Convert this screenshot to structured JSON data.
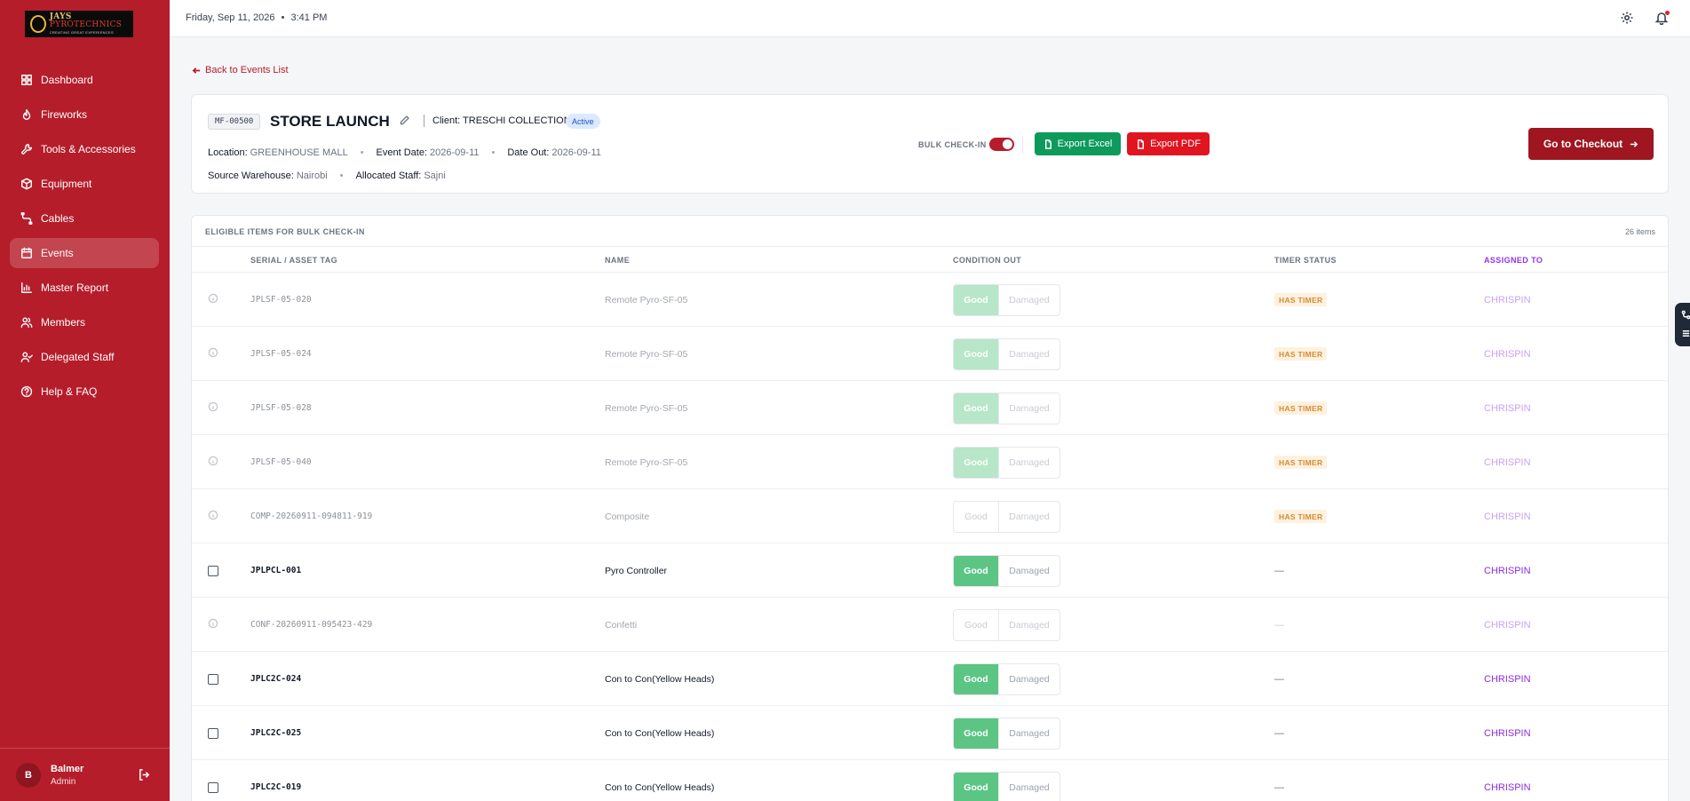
{
  "brand": {
    "logo_line1_a": "JAYS ",
    "logo_line1_b": "PYROTECHNICS",
    "logo_line2": "CREATING GREAT EXPERIENCES"
  },
  "sidebar": {
    "items": [
      {
        "label": "Dashboard",
        "icon": "grid-icon",
        "active": false
      },
      {
        "label": "Fireworks",
        "icon": "flame-icon",
        "active": false
      },
      {
        "label": "Tools & Accessories",
        "icon": "wrench-icon",
        "active": false
      },
      {
        "label": "Equipment",
        "icon": "box-icon",
        "active": false
      },
      {
        "label": "Cables",
        "icon": "cable-icon",
        "active": false
      },
      {
        "label": "Events",
        "icon": "calendar-icon",
        "active": true
      },
      {
        "label": "Master Report",
        "icon": "chart-icon",
        "active": false
      },
      {
        "label": "Members",
        "icon": "users-icon",
        "active": false
      },
      {
        "label": "Delegated Staff",
        "icon": "user-check-icon",
        "active": false
      },
      {
        "label": "Help & FAQ",
        "icon": "help-icon",
        "active": false
      }
    ],
    "user": {
      "initial": "B",
      "name": "Balmer",
      "role": "Admin"
    }
  },
  "topbar": {
    "date": "Friday, Sep 11, 2026",
    "separator": "•",
    "time": "3:41 PM"
  },
  "back_link": "Back to Events List",
  "event": {
    "code": "MF-00500",
    "title": "STORE LAUNCH",
    "client_label": "Client:",
    "client": "TRESCHI COLLECTION",
    "status": "Active",
    "location_label": "Location:",
    "location": "GREENHOUSE MALL",
    "event_date_label": "Event Date:",
    "event_date": "2026-09-11",
    "date_out_label": "Date Out:",
    "date_out": "2026-09-11",
    "warehouse_label": "Source Warehouse:",
    "warehouse": "Nairobi",
    "staff_label": "Allocated Staff:",
    "staff": "Sajni",
    "dot": "•"
  },
  "actions": {
    "bulk_label": "BULK CHECK-IN",
    "export_excel": "Export Excel",
    "export_pdf": "Export PDF",
    "checkout": "Go to Checkout"
  },
  "table": {
    "caption": "ELIGIBLE ITEMS FOR BULK CHECK-IN",
    "count": "26 items",
    "headers": {
      "serial": "SERIAL / ASSET TAG",
      "name": "NAME",
      "condition": "CONDITION OUT",
      "timer": "TIMER STATUS",
      "assigned": "ASSIGNED TO"
    },
    "good_label": "Good",
    "damaged_label": "Damaged",
    "timer_label": "HAS TIMER",
    "dash": "—",
    "rows": [
      {
        "serial": "JPLSF-05-020",
        "name": "Remote Pyro-SF-05",
        "eligible": false,
        "condition": "faded",
        "timer": true,
        "assigned": "CHRISPIN"
      },
      {
        "serial": "JPLSF-05-024",
        "name": "Remote Pyro-SF-05",
        "eligible": false,
        "condition": "faded",
        "timer": true,
        "assigned": "CHRISPIN"
      },
      {
        "serial": "JPLSF-05-028",
        "name": "Remote Pyro-SF-05",
        "eligible": false,
        "condition": "faded",
        "timer": true,
        "assigned": "CHRISPIN"
      },
      {
        "serial": "JPLSF-05-040",
        "name": "Remote Pyro-SF-05",
        "eligible": false,
        "condition": "faded",
        "timer": true,
        "assigned": "CHRISPIN"
      },
      {
        "serial": "COMP-20260911-094811-919",
        "name": "Composite",
        "eligible": false,
        "condition": "none",
        "timer": true,
        "assigned": "CHRISPIN"
      },
      {
        "serial": "JPLPCL-001",
        "name": "Pyro Controller",
        "eligible": true,
        "condition": "on",
        "timer": false,
        "assigned": "CHRISPIN"
      },
      {
        "serial": "CONF-20260911-095423-429",
        "name": "Confetti",
        "eligible": false,
        "condition": "none",
        "timer": false,
        "assigned": "CHRISPIN"
      },
      {
        "serial": "JPLC2C-024",
        "name": "Con to Con(Yellow Heads)",
        "eligible": true,
        "condition": "on",
        "timer": false,
        "assigned": "CHRISPIN"
      },
      {
        "serial": "JPLC2C-025",
        "name": "Con to Con(Yellow Heads)",
        "eligible": true,
        "condition": "on",
        "timer": false,
        "assigned": "CHRISPIN"
      },
      {
        "serial": "JPLC2C-019",
        "name": "Con to Con(Yellow Heads)",
        "eligible": true,
        "condition": "on",
        "timer": false,
        "assigned": "CHRISPIN"
      }
    ]
  }
}
